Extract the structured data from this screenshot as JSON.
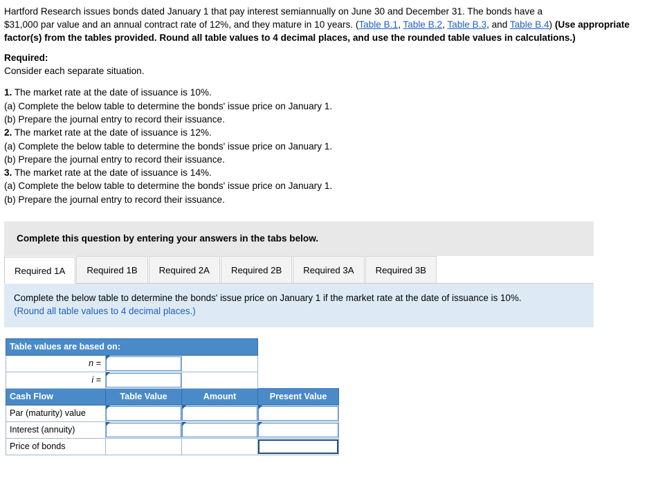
{
  "problem": {
    "line1_a": "Hartford Research issues bonds dated January 1 that pay interest semiannually on June 30 and December 31. The bonds have a",
    "line2_a": "$31,000 par value and an annual contract rate of 12%, and they mature in 10 years. (",
    "table_links": [
      "Table B.1",
      "Table B.2",
      "Table B.3",
      "Table B.4"
    ],
    "line2_mid1": ", ",
    "line2_mid2": ", ",
    "line2_mid3": ", and ",
    "line2_close": ") ",
    "bold_tail": "(Use appropriate factor(s) from the tables provided. Round all table values to 4 decimal places, and use the rounded table values in calculations.)"
  },
  "required": {
    "title": "Required:",
    "subtitle": "Consider each separate situation."
  },
  "items": [
    {
      "num": "1.",
      "text": " The market rate at the date of issuance is 10%."
    },
    {
      "num": "",
      "text": "(a) Complete the below table to determine the bonds' issue price on January 1."
    },
    {
      "num": "",
      "text": "(b) Prepare the journal entry to record their issuance."
    },
    {
      "num": "2.",
      "text": " The market rate at the date of issuance is 12%."
    },
    {
      "num": "",
      "text": "(a) Complete the below table to determine the bonds' issue price on January 1."
    },
    {
      "num": "",
      "text": "(b) Prepare the journal entry to record their issuance."
    },
    {
      "num": "3.",
      "text": " The market rate at the date of issuance is 14%."
    },
    {
      "num": "",
      "text": "(a) Complete the below table to determine the bonds' issue price on January 1."
    },
    {
      "num": "",
      "text": "(b) Prepare the journal entry to record their issuance."
    }
  ],
  "banner": {
    "text": "Complete this question by entering your answers in the tabs below."
  },
  "tabs": [
    {
      "label": "Required 1A",
      "active": true
    },
    {
      "label": "Required 1B",
      "active": false
    },
    {
      "label": "Required 2A",
      "active": false
    },
    {
      "label": "Required 2B",
      "active": false
    },
    {
      "label": "Required 3A",
      "active": false
    },
    {
      "label": "Required 3B",
      "active": false
    }
  ],
  "subpanel": {
    "line1": "Complete the below table to determine the bonds' issue price on January 1 if the market rate at the date of issuance is 10%.",
    "line2": "(Round all table values to 4 decimal places.)"
  },
  "answer_table": {
    "basis_header": "Table values are based on:",
    "n_label": "n =",
    "i_label": "i =",
    "n_value": "",
    "i_value": "",
    "columns": [
      "Cash Flow",
      "Table Value",
      "Amount",
      "Present Value"
    ],
    "rows": [
      {
        "label": "Par (maturity) value",
        "table_value": "",
        "amount": "",
        "present_value": ""
      },
      {
        "label": "Interest (annuity)",
        "table_value": "",
        "amount": "",
        "present_value": ""
      },
      {
        "label": "Price of bonds",
        "table_value": "",
        "amount": "",
        "present_value": ""
      }
    ]
  },
  "colors": {
    "header_blue": "#4a8ac9",
    "panel_blue": "#ddeaf6",
    "link_blue": "#1f5fbf",
    "banner_gray": "#e8e8e8"
  }
}
